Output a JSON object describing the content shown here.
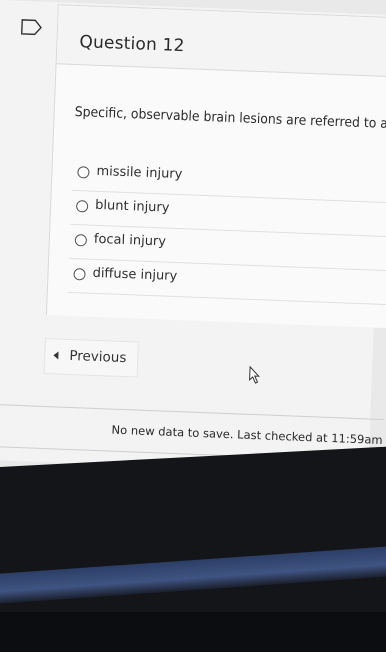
{
  "question": {
    "title": "Question 12",
    "text": "Specific, observable brain lesions are referred to as:",
    "options": [
      {
        "label": "missile injury",
        "selected": false
      },
      {
        "label": "blunt injury",
        "selected": false
      },
      {
        "label": "focal injury",
        "selected": false
      },
      {
        "label": "diffuse injury",
        "selected": false
      }
    ]
  },
  "navigation": {
    "previous_label": "Previous"
  },
  "status": {
    "save_message": "No new data to save. Last checked at 11:59am"
  },
  "icons": {
    "flag": "flag-icon",
    "previous": "chevron-left-icon",
    "cursor": "mouse-pointer-icon"
  }
}
